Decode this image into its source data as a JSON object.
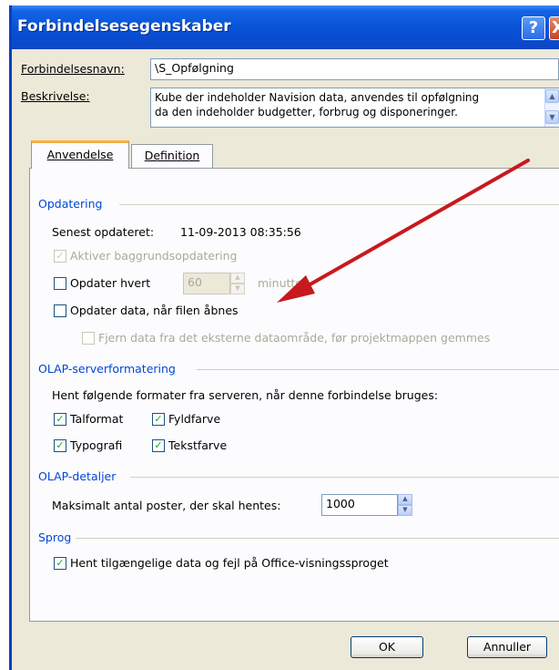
{
  "window": {
    "title": "Forbindelsesegenskaber",
    "help_glyph": "?",
    "close_glyph": "X"
  },
  "connection": {
    "name_label": "Forbindelsesnavn:",
    "name_value": "\\S_Opfølgning",
    "desc_label": "Beskrivelse:",
    "desc_line1": "Kube der indeholder Navision data, anvendes til opfølgning",
    "desc_line2": "da den indeholder budgetter, forbrug og disponeringer."
  },
  "tabs": [
    {
      "label": "Anvendelse",
      "active": true
    },
    {
      "label": "Definition",
      "active": false
    }
  ],
  "refresh": {
    "group_title": "Opdatering",
    "last_updated_label": "Senest opdateret:",
    "last_updated_value": "11-09-2013 08:35:56",
    "background_refresh": "Aktiver baggrundsopdatering",
    "refresh_every": "Opdater hvert",
    "refresh_minutes_value": "60",
    "minutes_label": "minutter",
    "refresh_on_open": "Opdater data, når filen åbnes",
    "remove_external": "Fjern data fra det eksterne dataområde, før projektmappen gemmes"
  },
  "olap_format": {
    "group_title": "OLAP-serverformatering",
    "intro": "Hent følgende formater fra serveren, når denne forbindelse bruges:",
    "number_format": "Talformat",
    "fill_color": "Fyldfarve",
    "typography": "Typografi",
    "text_color": "Tekstfarve"
  },
  "olap_details": {
    "group_title": "OLAP-detaljer",
    "max_records_label": "Maksimalt antal poster, der skal hentes:",
    "max_records_value": "1000"
  },
  "language": {
    "group_title": "Sprog",
    "office_language": "Hent tilgængelige data og fejl på Office-visningssproget"
  },
  "buttons": {
    "ok": "OK",
    "cancel": "Annuller"
  },
  "check_glyph": "✓",
  "colors": {
    "titlebar": "#0753d6",
    "dialog_bg": "#ece9d8",
    "group_title": "#0046d5",
    "annotation_arrow": "#c8191e"
  }
}
